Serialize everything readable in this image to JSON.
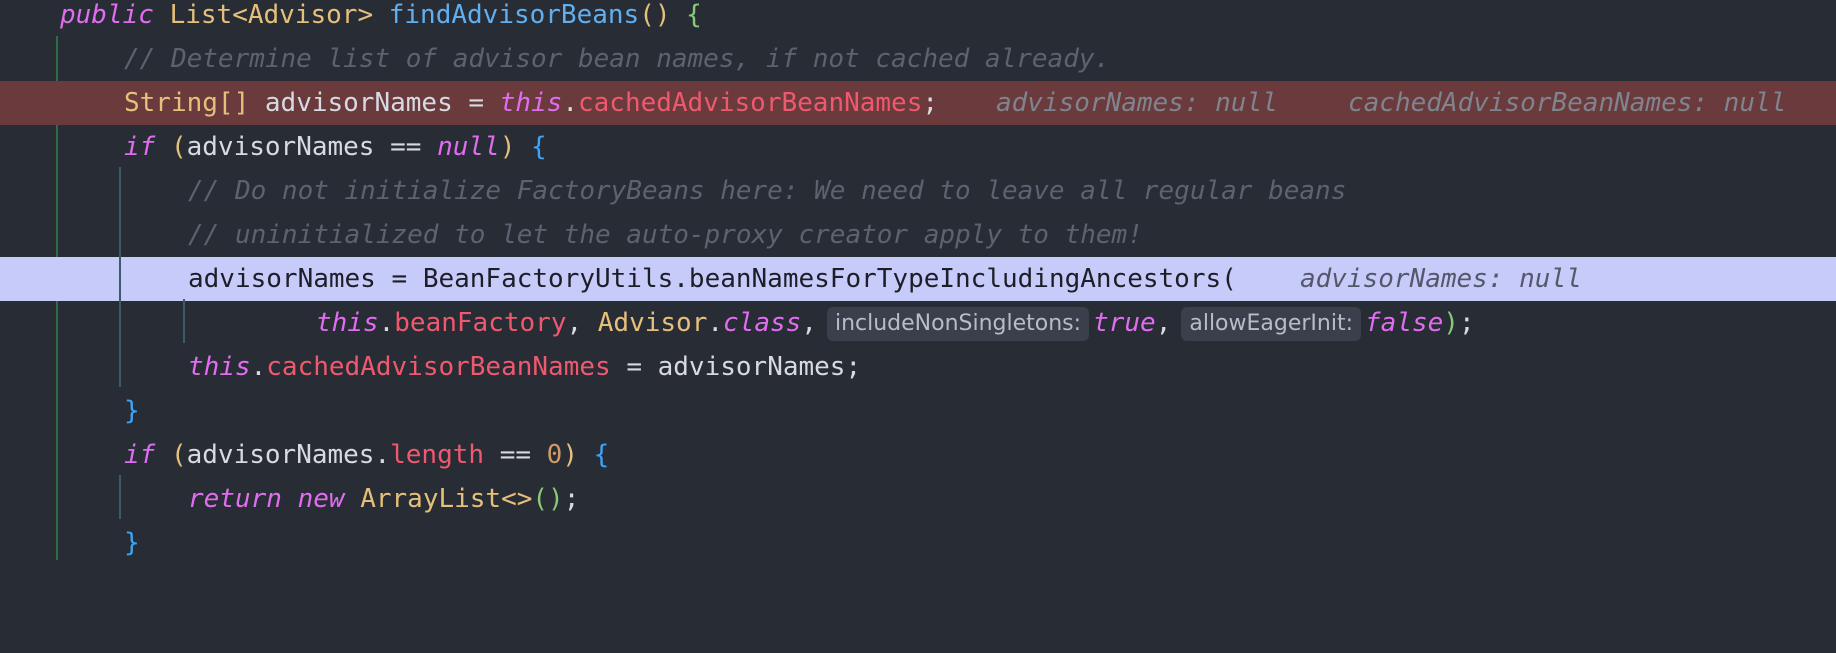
{
  "method": {
    "kw_public": "public",
    "return_type": "List",
    "generic_open": "<",
    "generic_type": "Advisor",
    "generic_close": ">",
    "name": "findAdvisorBeans",
    "parens": "()",
    "brace_open": "{"
  },
  "line2": {
    "comment": "// Determine list of advisor bean names, if not cached already."
  },
  "line3": {
    "type": "String[]",
    "var": "advisorNames",
    "op": "=",
    "kw_this": "this",
    "dot": ".",
    "field": "cachedAdvisorBeanNames",
    "semi": ";",
    "debug_value_1": "advisorNames: null",
    "debug_value_2": "cachedAdvisorBeanNames: null"
  },
  "line4": {
    "kw_if": "if",
    "paren_open": "(",
    "var": "advisorNames",
    "op": "==",
    "kw_null": "null",
    "paren_close": ")",
    "brace_open": "{"
  },
  "line5": {
    "comment": "// Do not initialize FactoryBeans here: We need to leave all regular beans"
  },
  "line6": {
    "comment": "// uninitialized to let the auto-proxy creator apply to them!"
  },
  "line7": {
    "var": "advisorNames",
    "op": "=",
    "call": "BeanFactoryUtils.beanNamesForTypeIncludingAncestors",
    "paren_open": "(",
    "debug_value": "advisorNames: null"
  },
  "line8": {
    "kw_this": "this",
    "dot": ".",
    "field": "beanFactory",
    "comma1": ",",
    "class_type": "Advisor",
    "dot2": ".",
    "kw_class": "class",
    "comma2": ",",
    "hint_1": "includeNonSingletons:",
    "kw_true": "true",
    "comma3": ",",
    "hint_2": "allowEagerInit:",
    "kw_false": "false",
    "paren_close": ")",
    "semi": ";"
  },
  "line9": {
    "kw_this": "this",
    "dot": ".",
    "field": "cachedAdvisorBeanNames",
    "op": "=",
    "var": "advisorNames",
    "semi": ";"
  },
  "line10": {
    "brace_close": "}"
  },
  "line11": {
    "kw_if": "if",
    "paren_open": "(",
    "var": "advisorNames",
    "dot": ".",
    "field": "length",
    "op": "==",
    "num": "0",
    "paren_close": ")",
    "brace_open": "{"
  },
  "line12": {
    "kw_return": "return",
    "kw_new": "new",
    "type": "ArrayList",
    "diamond": "<>",
    "parens": "()",
    "semi": ";"
  },
  "line13": {
    "brace_close": "}"
  },
  "colors": {
    "background": "#282c34",
    "breakpoint_line": "#6b3a3c",
    "current_line": "#c7cbfa",
    "keyword": "#e06cf0",
    "field": "#ef596f",
    "function": "#61afef",
    "type": "#e5c07b",
    "comment": "#5c6370"
  }
}
